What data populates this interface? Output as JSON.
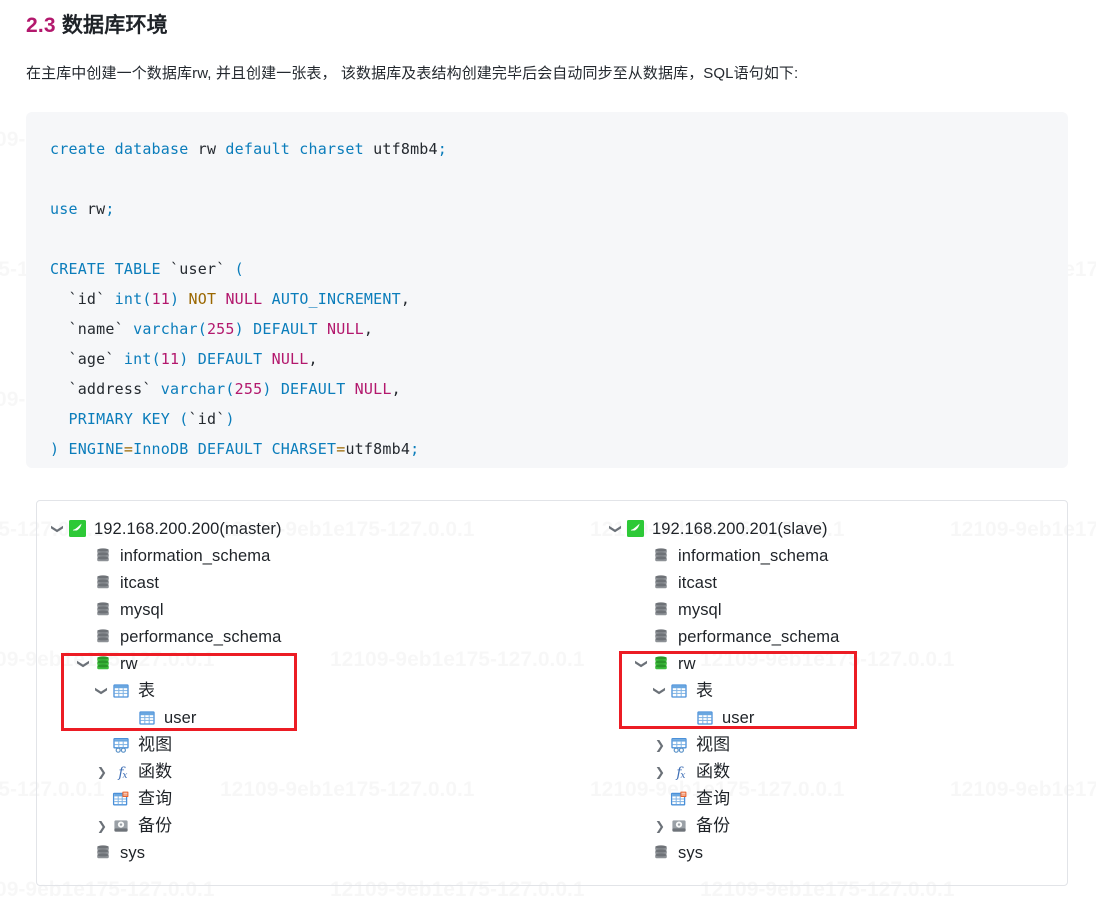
{
  "heading": {
    "number": "2.3",
    "title": "数据库环境"
  },
  "paragraph": "在主库中创建一个数据库rw, 并且创建一张表， 该数据库及表结构创建完毕后会自动同步至从数据库，SQL语句如下:",
  "code": {
    "language": "sql",
    "lines": [
      "create database rw default charset utf8mb4;",
      "",
      "use rw;",
      "",
      "CREATE TABLE `user` (",
      "  `id` int(11) NOT NULL AUTO_INCREMENT,",
      "  `name` varchar(255) DEFAULT NULL,",
      "  `age` int(11) DEFAULT NULL,",
      "  `address` varchar(255) DEFAULT NULL,",
      "  PRIMARY KEY (`id`)",
      ") ENGINE=InnoDB DEFAULT CHARSET=utf8mb4;"
    ]
  },
  "watermark": "12109-9eb1e175-127.0.0.1",
  "trees": {
    "left": {
      "server_label": "192.168.200.200(master)",
      "server_icon": "mysql-server-icon",
      "nodes": [
        {
          "label": "information_schema",
          "icon": "database-icon",
          "indent": 1,
          "chevron": "none"
        },
        {
          "label": "itcast",
          "icon": "database-icon",
          "indent": 1,
          "chevron": "none"
        },
        {
          "label": "mysql",
          "icon": "database-icon",
          "indent": 1,
          "chevron": "none"
        },
        {
          "label": "performance_schema",
          "icon": "database-icon",
          "indent": 1,
          "chevron": "none"
        },
        {
          "label": "rw",
          "icon": "database-green-icon",
          "indent": 1,
          "chevron": "down"
        },
        {
          "label": "表",
          "icon": "table-folder-icon",
          "indent": 2,
          "chevron": "down"
        },
        {
          "label": "user",
          "icon": "table-icon",
          "indent": 3,
          "chevron": "none"
        },
        {
          "label": "视图",
          "icon": "view-icon",
          "indent": 2,
          "chevron": "none"
        },
        {
          "label": "函数",
          "icon": "function-icon",
          "indent": 2,
          "chevron": "right"
        },
        {
          "label": "查询",
          "icon": "query-icon",
          "indent": 2,
          "chevron": "none"
        },
        {
          "label": "备份",
          "icon": "backup-icon",
          "indent": 2,
          "chevron": "right"
        },
        {
          "label": "sys",
          "icon": "database-icon",
          "indent": 1,
          "chevron": "none"
        }
      ]
    },
    "right": {
      "server_label": "192.168.200.201(slave)",
      "server_icon": "mysql-server-icon",
      "nodes": [
        {
          "label": "information_schema",
          "icon": "database-icon",
          "indent": 1,
          "chevron": "none"
        },
        {
          "label": "itcast",
          "icon": "database-icon",
          "indent": 1,
          "chevron": "none"
        },
        {
          "label": "mysql",
          "icon": "database-icon",
          "indent": 1,
          "chevron": "none"
        },
        {
          "label": "performance_schema",
          "icon": "database-icon",
          "indent": 1,
          "chevron": "none"
        },
        {
          "label": "rw",
          "icon": "database-green-icon",
          "indent": 1,
          "chevron": "down"
        },
        {
          "label": "表",
          "icon": "table-folder-icon",
          "indent": 2,
          "chevron": "down"
        },
        {
          "label": "user",
          "icon": "table-icon",
          "indent": 3,
          "chevron": "none"
        },
        {
          "label": "视图",
          "icon": "view-icon",
          "indent": 2,
          "chevron": "right"
        },
        {
          "label": "函数",
          "icon": "function-icon",
          "indent": 2,
          "chevron": "right"
        },
        {
          "label": "查询",
          "icon": "query-icon",
          "indent": 2,
          "chevron": "none"
        },
        {
          "label": "备份",
          "icon": "backup-icon",
          "indent": 2,
          "chevron": "right"
        },
        {
          "label": "sys",
          "icon": "database-icon",
          "indent": 1,
          "chevron": "none"
        }
      ]
    }
  },
  "colors": {
    "highlight_box": "#ec1c24",
    "code_bg": "#f6f7f9",
    "keyword": "#0b7dbb",
    "literal": "#b3186d",
    "server_green": "#2dc937"
  }
}
